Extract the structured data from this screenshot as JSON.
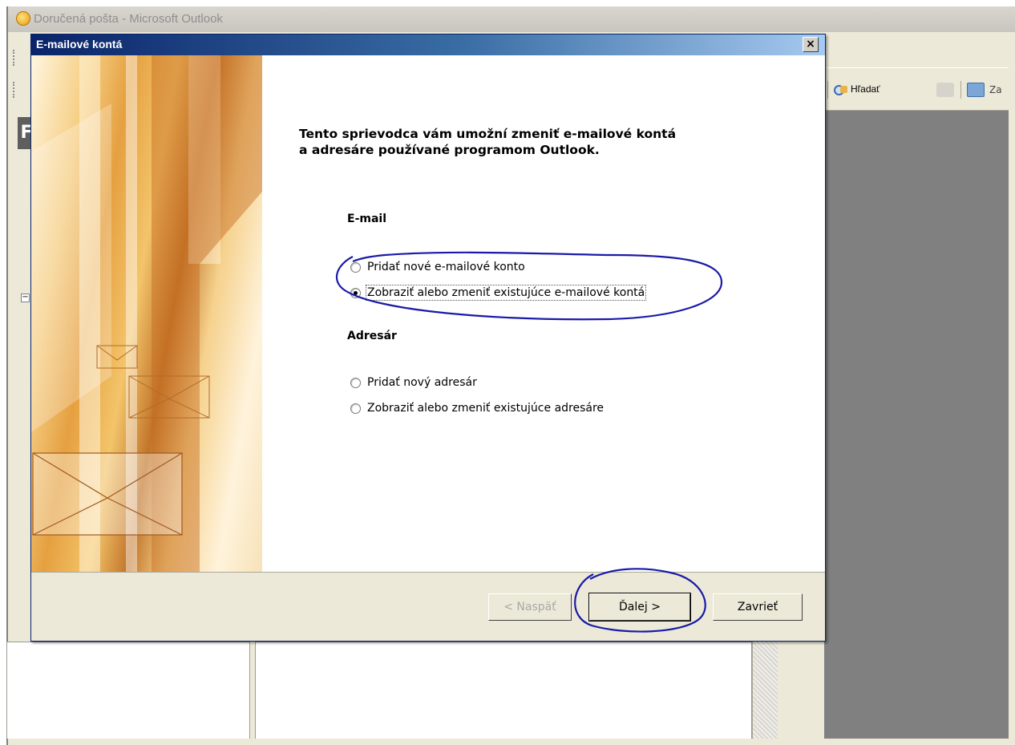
{
  "background_window": {
    "title": "Doručená pošta - Microsoft Outlook",
    "toolbar": {
      "find_label": "Hľadať",
      "truncated_label": "Za"
    },
    "nav_letter": "F",
    "tree_toggle": "−"
  },
  "dialog": {
    "title": "E-mailové kontá",
    "close_glyph": "×",
    "intro_line1": "Tento sprievodca vám umožní zmeniť e-mailové kontá",
    "intro_line2": "a adresáre používané programom Outlook.",
    "email_heading": "E-mail",
    "email_options": [
      {
        "label": "Pridať nové e-mailové konto",
        "selected": false
      },
      {
        "label": "Zobraziť alebo zmeniť existujúce e-mailové kontá",
        "selected": true
      }
    ],
    "addressbook_heading": "Adresár",
    "addressbook_options": [
      {
        "label": "Pridať nový adresár",
        "selected": false
      },
      {
        "label": "Zobraziť alebo zmeniť existujúce adresáre",
        "selected": false
      }
    ],
    "buttons": {
      "back": "< Naspäť",
      "next": "Ďalej >",
      "close": "Zavrieť"
    }
  },
  "colors": {
    "title_gradient_start": "#0a246a",
    "dialog_face": "#ece9d8",
    "annotation_ink": "#1a1aa8"
  }
}
